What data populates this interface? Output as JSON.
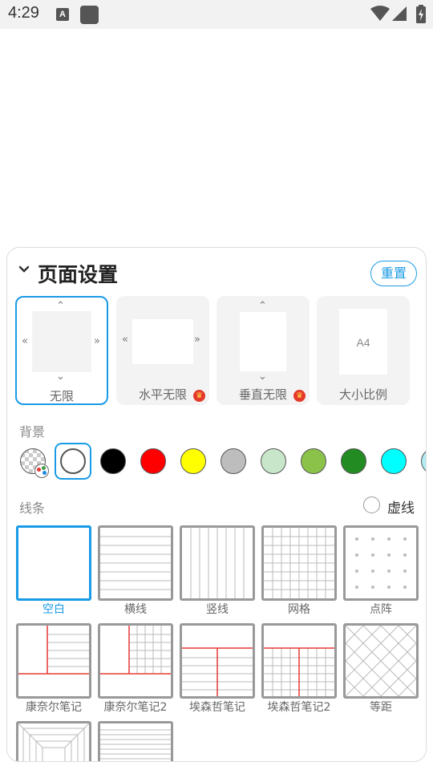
{
  "status_bar": {
    "time": "4:29",
    "notification_icon_letter": "A"
  },
  "panel": {
    "title": "页面设置",
    "reset_label": "重置"
  },
  "page_sizes": [
    {
      "label": "无限",
      "selected": true,
      "vip": false
    },
    {
      "label": "水平无限",
      "selected": false,
      "vip": true
    },
    {
      "label": "垂直无限",
      "selected": false,
      "vip": true
    },
    {
      "label": "大小比例",
      "paper_text": "A4",
      "selected": false,
      "vip": false
    }
  ],
  "background": {
    "label": "背景",
    "colors": [
      {
        "name": "transparent",
        "hex": "transparent"
      },
      {
        "name": "white",
        "hex": "#ffffff",
        "selected": true
      },
      {
        "name": "black",
        "hex": "#000000"
      },
      {
        "name": "red",
        "hex": "#ff0000"
      },
      {
        "name": "yellow",
        "hex": "#ffff00"
      },
      {
        "name": "gray",
        "hex": "#bdbdbd"
      },
      {
        "name": "light-green",
        "hex": "#c8e6c9"
      },
      {
        "name": "yellow-green",
        "hex": "#8bc34a"
      },
      {
        "name": "green",
        "hex": "#228b22"
      },
      {
        "name": "cyan",
        "hex": "#00ffff"
      },
      {
        "name": "light-cyan",
        "hex": "#b2ebf2"
      }
    ]
  },
  "lines": {
    "label": "线条",
    "dashed_label": "虚线",
    "dashed_checked": false,
    "patterns": [
      {
        "label": "空白",
        "selected": true
      },
      {
        "label": "横线"
      },
      {
        "label": "竖线"
      },
      {
        "label": "网格"
      },
      {
        "label": "点阵"
      },
      {
        "label": "康奈尔笔记"
      },
      {
        "label": "康奈尔笔记2"
      },
      {
        "label": "埃森哲笔记"
      },
      {
        "label": "埃森哲笔记2"
      },
      {
        "label": "等距"
      },
      {
        "label": ""
      },
      {
        "label": ""
      }
    ]
  },
  "colors": {
    "accent": "#1a9be6",
    "red_line": "#e53935",
    "vip_badge": "#e3382a"
  }
}
